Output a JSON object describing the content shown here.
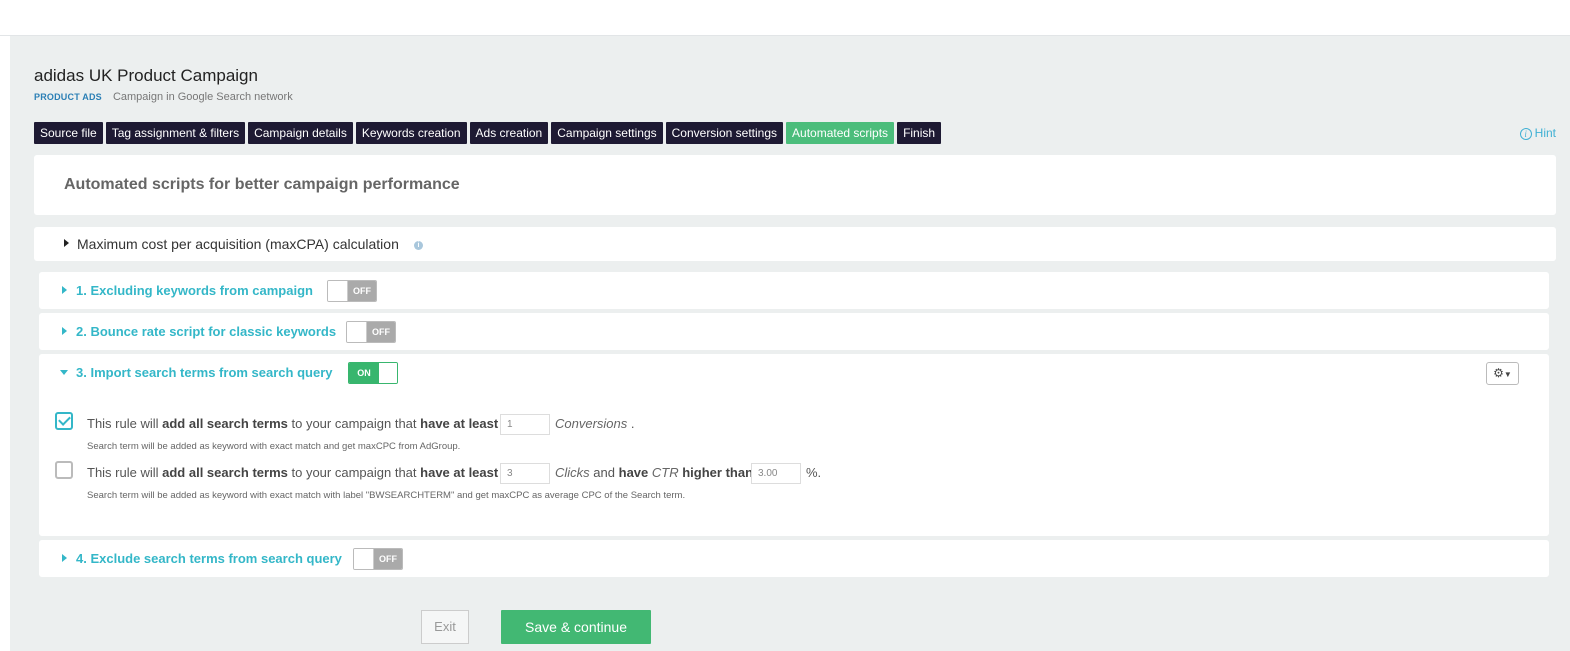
{
  "campaign": {
    "title": "adidas UK Product Campaign",
    "type_tag": "PRODUCT ADS",
    "network": "Campaign in Google Search network"
  },
  "steps": [
    {
      "label": "Source file",
      "active": false
    },
    {
      "label": "Tag assignment & filters",
      "active": false
    },
    {
      "label": "Campaign details",
      "active": false
    },
    {
      "label": "Keywords creation",
      "active": false
    },
    {
      "label": "Ads creation",
      "active": false
    },
    {
      "label": "Campaign settings",
      "active": false
    },
    {
      "label": "Conversion settings",
      "active": false
    },
    {
      "label": "Automated scripts",
      "active": true
    },
    {
      "label": "Finish",
      "active": false
    }
  ],
  "hint": {
    "label": "Hint",
    "icon": "info-icon"
  },
  "section_heading": "Automated scripts for better campaign performance",
  "maxcpa": {
    "label": "Maximum cost per acquisition (maxCPA) calculation",
    "icon": "info-icon"
  },
  "rules": {
    "r1": {
      "title": "1. Excluding keywords from campaign",
      "toggle": "OFF",
      "expanded": false
    },
    "r2": {
      "title": "2. Bounce rate script for classic keywords",
      "toggle": "OFF",
      "expanded": false
    },
    "r3": {
      "title": "3. Import search terms from search query",
      "toggle": "ON",
      "expanded": true,
      "settings_icon": "gear-icon",
      "options": [
        {
          "checked": true,
          "pre": "This rule will",
          "bold1": "add all search terms",
          "mid": "to your campaign that",
          "bold2": "have at least",
          "value": "1",
          "unit": "Conversions",
          "end": ".",
          "note": "Search term will be added as keyword with exact match and get maxCPC from AdGroup."
        },
        {
          "checked": false,
          "pre": "This rule will",
          "bold1": "add all search terms",
          "mid": "to your campaign that",
          "bold2": "have at least",
          "value": "3",
          "unit": "Clicks",
          "and": "and",
          "bold3": "have",
          "metric": "CTR",
          "bold4": "higher than",
          "value2": "3.00",
          "end": "%.",
          "note": "Search term will be added as keyword with exact match with label \"BWSEARCHTERM\" and get maxCPC as average CPC of the Search term."
        }
      ]
    },
    "r4": {
      "title": "4. Exclude search terms from search query",
      "toggle": "OFF",
      "expanded": false
    }
  },
  "actions": {
    "exit": "Exit",
    "save": "Save & continue"
  },
  "colors": {
    "accent": "#34b7c8",
    "success": "#42b873",
    "nav": "#1e1a33",
    "background": "#ecefef"
  }
}
